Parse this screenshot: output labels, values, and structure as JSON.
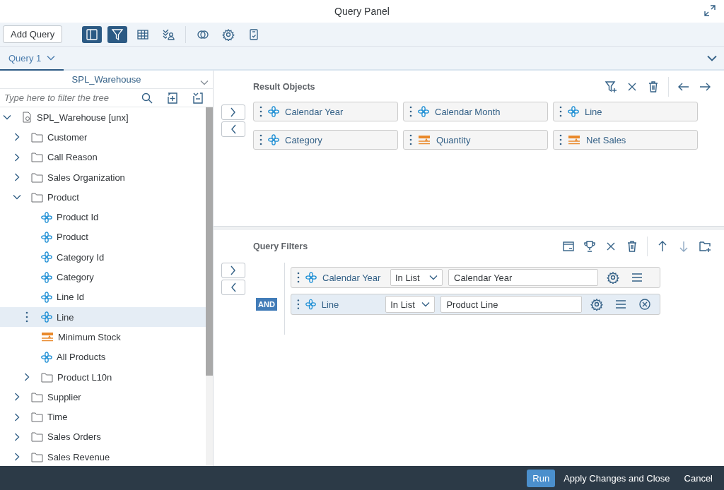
{
  "window": {
    "title": "Query Panel"
  },
  "toolbar": {
    "add_button": "Add Query",
    "tools": [
      {
        "kind": "panel",
        "selected": true
      },
      {
        "kind": "filter",
        "selected": true
      },
      {
        "kind": "table",
        "selected": false
      },
      {
        "kind": "user-filter",
        "selected": false
      },
      {
        "kind": "circles",
        "selected": false
      },
      {
        "kind": "gear",
        "selected": false
      },
      {
        "kind": "report",
        "selected": false
      }
    ]
  },
  "tabs": [
    {
      "label": "Query 1",
      "selected": true
    }
  ],
  "universe_selector": {
    "value": "SPL_Warehouse"
  },
  "tree_filter": {
    "placeholder": "Type here to filter the tree"
  },
  "tree": [
    {
      "label": "SPL_Warehouse [unx]",
      "kind": "universe",
      "expanded": true,
      "selected": false,
      "children": [
        {
          "label": "Customer",
          "kind": "folder",
          "expanded": false,
          "selected": false
        },
        {
          "label": "Call Reason",
          "kind": "folder",
          "expanded": false,
          "selected": false
        },
        {
          "label": "Sales Organization",
          "kind": "folder",
          "expanded": false,
          "selected": false
        },
        {
          "label": "Product",
          "kind": "folder",
          "expanded": true,
          "selected": false,
          "children": [
            {
              "label": "Product Id",
              "kind": "dimension",
              "selected": false
            },
            {
              "label": "Product",
              "kind": "dimension",
              "selected": false
            },
            {
              "label": "Category Id",
              "kind": "dimension",
              "selected": false
            },
            {
              "label": "Category",
              "kind": "dimension",
              "selected": false
            },
            {
              "label": "Line Id",
              "kind": "dimension",
              "selected": false
            },
            {
              "label": "Line",
              "kind": "dimension",
              "selected": true
            },
            {
              "label": "Minimum Stock",
              "kind": "measure",
              "selected": false
            },
            {
              "label": "All Products",
              "kind": "dimension",
              "selected": false
            },
            {
              "label": "Product L10n",
              "kind": "folder",
              "expanded": false,
              "selected": false
            }
          ]
        },
        {
          "label": "Supplier",
          "kind": "folder",
          "expanded": false,
          "selected": false
        },
        {
          "label": "Time",
          "kind": "folder",
          "expanded": false,
          "selected": false
        },
        {
          "label": "Sales Orders",
          "kind": "folder",
          "expanded": false,
          "selected": false
        },
        {
          "label": "Sales Revenue",
          "kind": "folder",
          "expanded": false,
          "selected": false
        }
      ]
    }
  ],
  "result_objects": {
    "title": "Result Objects",
    "items": [
      {
        "label": "Calendar Year",
        "kind": "dimension"
      },
      {
        "label": "Calendar Month",
        "kind": "dimension"
      },
      {
        "label": "Line",
        "kind": "dimension"
      },
      {
        "label": "Category",
        "kind": "dimension"
      },
      {
        "label": "Quantity",
        "kind": "measure"
      },
      {
        "label": "Net Sales",
        "kind": "measure"
      }
    ]
  },
  "query_filters": {
    "title": "Query Filters",
    "operator": "AND",
    "rows": [
      {
        "field": "Calendar Year",
        "kind": "dimension",
        "operator": "In List",
        "value": "Calendar Year",
        "selected": false
      },
      {
        "field": "Line",
        "kind": "dimension",
        "operator": "In List",
        "value": "Product Line",
        "selected": true
      }
    ]
  },
  "footer": {
    "buttons": [
      {
        "label": "Run",
        "kind": "primary"
      },
      {
        "label": "Apply Changes and Close",
        "kind": "plain"
      },
      {
        "label": "Cancel",
        "kind": "plain"
      }
    ]
  }
}
